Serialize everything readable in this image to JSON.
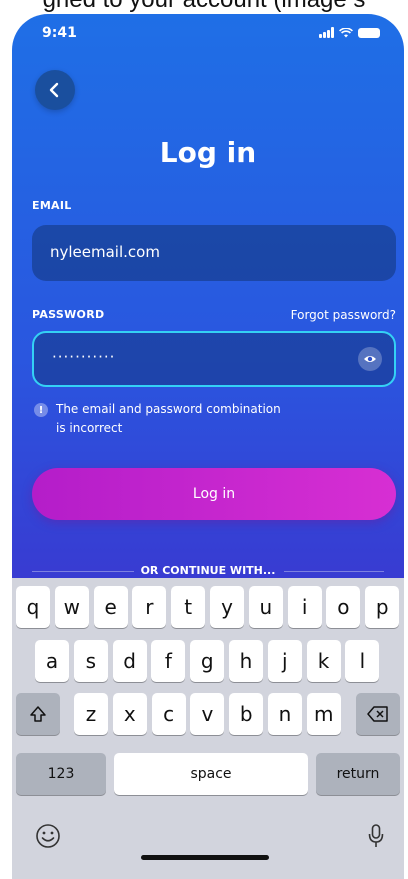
{
  "caption": "gned to your account (image s",
  "status_bar": {
    "time": "9:41"
  },
  "screen": {
    "title": "Log in",
    "email": {
      "label": "EMAIL",
      "value": "nyleemail.com"
    },
    "password": {
      "label": "PASSWORD",
      "value": "···········",
      "forgot_link": "Forgot password?"
    },
    "error": {
      "icon": "!",
      "line1": "The email and password combination",
      "line2": "is incorrect"
    },
    "login_button": "Log in",
    "divider_text": "OR CONTINUE WITH..."
  },
  "keyboard": {
    "row1": [
      "q",
      "w",
      "e",
      "r",
      "t",
      "y",
      "u",
      "i",
      "o",
      "p"
    ],
    "row2": [
      "a",
      "s",
      "d",
      "f",
      "g",
      "h",
      "j",
      "k",
      "l"
    ],
    "row3": [
      "z",
      "x",
      "c",
      "v",
      "b",
      "n",
      "m"
    ],
    "numbers_key": "123",
    "space_key": "space",
    "return_key": "return"
  },
  "colors": {
    "gradient_top": "#1f6fe6",
    "gradient_bottom": "#5a2bc7",
    "focus_border": "#34d1f5",
    "button": "#c425cf",
    "keyboard_bg": "#d2d4dd"
  },
  "icons": {
    "back": "chevron-left-icon",
    "eye": "eye-icon",
    "shift": "shift-icon",
    "delete": "backspace-icon",
    "emoji": "emoji-icon",
    "mic": "microphone-icon"
  }
}
